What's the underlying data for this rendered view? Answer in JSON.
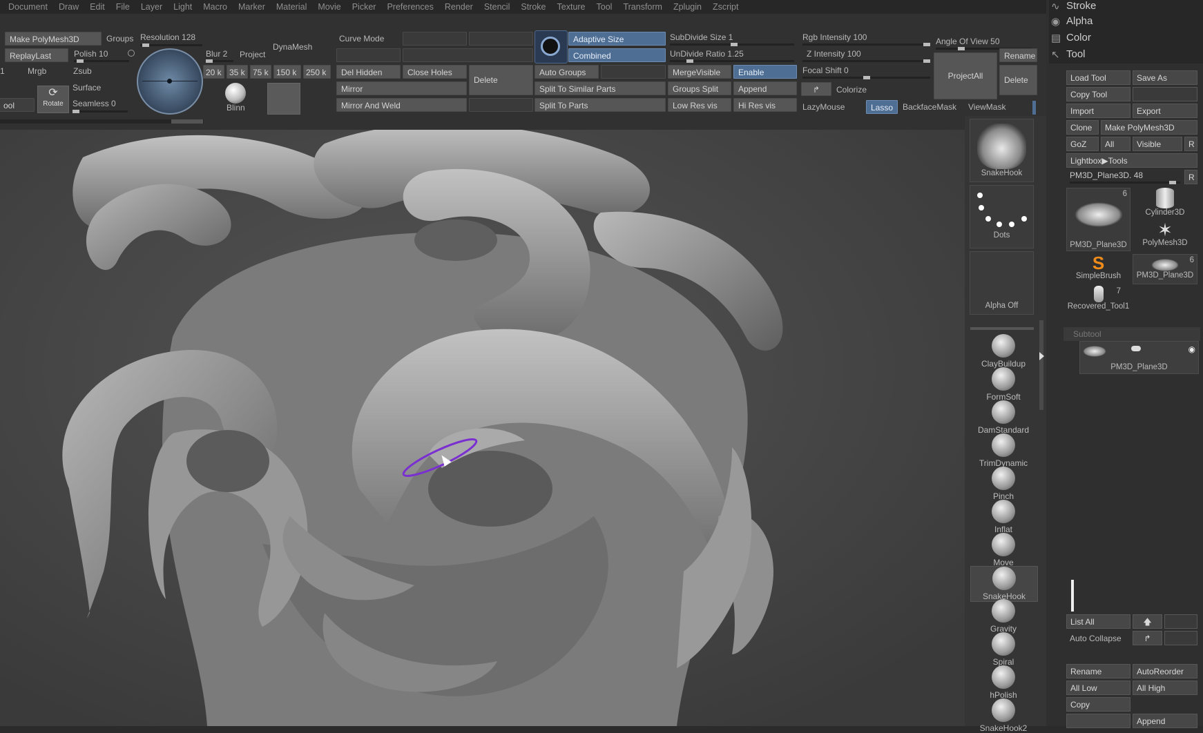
{
  "menu": [
    "Document",
    "Draw",
    "Edit",
    "File",
    "Layer",
    "Light",
    "Macro",
    "Marker",
    "Material",
    "Movie",
    "Picker",
    "Preferences",
    "Render",
    "Stencil",
    "Stroke",
    "Texture",
    "Tool",
    "Transform",
    "Zplugin",
    "Zscript"
  ],
  "palettes": [
    "Stroke",
    "Alpha",
    "Color",
    "Tool"
  ],
  "shelf": {
    "make_polymesh": "Make PolyMesh3D",
    "groups": "Groups",
    "resolution_label": "Resolution",
    "resolution_value": "128",
    "replay_last": "ReplayLast",
    "polish_label": "Polish",
    "polish_value": "10",
    "mrgb": "Mrgb",
    "zsub": "Zsub",
    "rotate": "Rotate",
    "surface": "Surface",
    "seamless_label": "Seamless",
    "seamless_value": "0",
    "tool_cut": "ool",
    "blur": "Blur 2",
    "project": "Project",
    "dynamesh": "DynaMesh",
    "res_20k": "20 k",
    "res_35k": "35 k",
    "res_75k": "75 k",
    "res_150k": "150 k",
    "res_250k": "250 k",
    "blinn": "Blinn",
    "curve_mode": "Curve Mode",
    "del_hidden": "Del Hidden",
    "close_holes": "Close Holes",
    "delete": "Delete",
    "mirror": "Mirror",
    "mirror_weld": "Mirror And Weld",
    "adaptive_size": "Adaptive Size",
    "combined": "Combined",
    "auto_groups": "Auto Groups",
    "split_similar": "Split To Similar Parts",
    "split_parts": "Split To Parts",
    "subdivide_label": "SubDivide Size",
    "subdivide_value": "1",
    "undivide_label": "UnDivide Ratio",
    "undivide_value": "1.25",
    "merge_visible": "MergeVisible",
    "enable": "Enable",
    "groups_split": "Groups Split",
    "append": "Append",
    "low_res_vis": "Low Res vis",
    "hi_res_vis": "Hi Res vis",
    "rgb_intensity_label": "Rgb Intensity",
    "rgb_intensity_value": "100",
    "z_intensity_label": "Z Intensity",
    "z_intensity_value": "100",
    "focal_shift_label": "Focal Shift",
    "focal_shift_value": "0",
    "colorize": "Colorize",
    "lazymouse": "LazyMouse",
    "lasso": "Lasso",
    "backface_mask": "BackfaceMask",
    "viewmask": "ViewMask",
    "angle_label": "Angle Of View",
    "angle_value": "50",
    "project_all": "ProjectAll",
    "rename": "Rename",
    "delete_right": "Delete"
  },
  "brush_column": {
    "top": [
      "SnakeHook",
      "Dots",
      "Alpha Off"
    ],
    "brushes": [
      "ClayBuildup",
      "FormSoft",
      "DamStandard",
      "TrimDynamic",
      "Pinch",
      "Inflat",
      "Move",
      "SnakeHook",
      "Gravity",
      "Spiral",
      "hPolish",
      "SnakeHook2"
    ]
  },
  "tool_panel": {
    "load_tool": "Load Tool",
    "save_as": "Save As",
    "copy_tool": "Copy Tool",
    "import": "Import",
    "export": "Export",
    "clone": "Clone",
    "make_polymesh": "Make PolyMesh3D",
    "goz": "GoZ",
    "all": "All",
    "visible": "Visible",
    "r": "R",
    "lightbox": "Lightbox▶Tools",
    "current_tool": "PM3D_Plane3D.",
    "current_tool_value": "48",
    "thumbs": [
      {
        "name": "PM3D_Plane3D",
        "count": "6"
      },
      {
        "name": "Cylinder3D",
        "count": ""
      },
      {
        "name": "PolyMesh3D",
        "count": ""
      },
      {
        "name": "SimpleBrush",
        "count": ""
      },
      {
        "name": "PM3D_Plane3D",
        "count": "6"
      },
      {
        "name": "Recovered_Tool1",
        "count": "7"
      }
    ],
    "subtool_header": "Subtool",
    "subtool_name": "PM3D_Plane3D",
    "list_all": "List All",
    "auto_collapse": "Auto Collapse",
    "rename": "Rename",
    "auto_reorder": "AutoReorder",
    "all_low": "All Low",
    "all_high": "All High",
    "copy": "Copy",
    "append": "Append"
  }
}
